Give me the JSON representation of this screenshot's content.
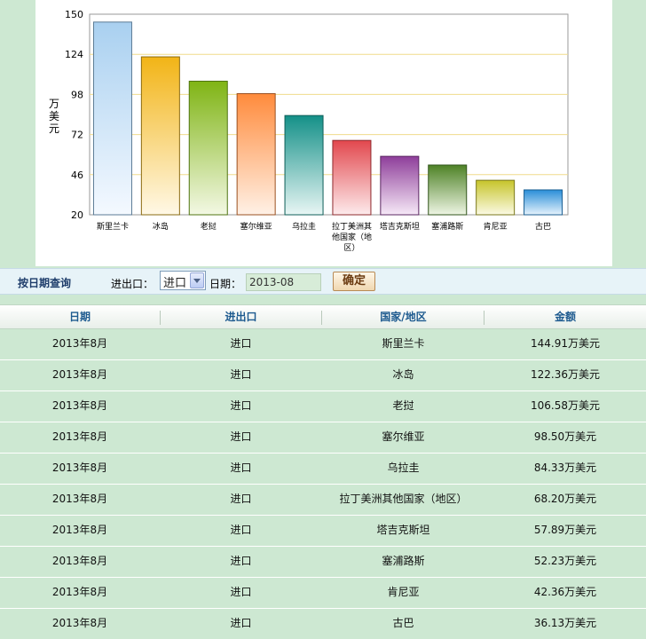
{
  "chart_data": {
    "type": "bar",
    "ylabel": "万美元",
    "ylim": [
      20,
      150
    ],
    "yticks": [
      150,
      124,
      98,
      72,
      46,
      20
    ],
    "grid": true,
    "categories": [
      "斯里兰卡",
      "冰岛",
      "老挝",
      "塞尔维亚",
      "乌拉圭",
      "拉丁美洲其他国家（地区）",
      "塔吉克斯坦",
      "塞浦路斯",
      "肯尼亚",
      "古巴"
    ],
    "values": [
      144.91,
      122.36,
      106.58,
      98.5,
      84.33,
      68.2,
      57.89,
      52.23,
      42.36,
      36.13
    ],
    "colors": [
      {
        "top": "#a9d0f0",
        "bottom": "#f4f9ff",
        "stroke": "#5a7a94"
      },
      {
        "top": "#f2b416",
        "bottom": "#fff8e6",
        "stroke": "#8a6a10"
      },
      {
        "top": "#7fb414",
        "bottom": "#f3f8e4",
        "stroke": "#4f7410"
      },
      {
        "top": "#ff8b3c",
        "bottom": "#fff1e6",
        "stroke": "#9a5020"
      },
      {
        "top": "#149088",
        "bottom": "#e8f6f4",
        "stroke": "#0e5e58"
      },
      {
        "top": "#e2484e",
        "bottom": "#fdebec",
        "stroke": "#8e2a2e"
      },
      {
        "top": "#8e3e9a",
        "bottom": "#f6e9f7",
        "stroke": "#5a2662"
      },
      {
        "top": "#4e8226",
        "bottom": "#eef5e4",
        "stroke": "#30541a"
      },
      {
        "top": "#c6c42a",
        "bottom": "#fbfae4",
        "stroke": "#7a781a"
      },
      {
        "top": "#2a8ed8",
        "bottom": "#e6f3fc",
        "stroke": "#1a5e92"
      }
    ]
  },
  "filter": {
    "title": "按日期查询",
    "type_label": "进出口：",
    "type_value": "进口",
    "date_label": "日期：",
    "date_value": "2013-08",
    "confirm_label": "确定"
  },
  "table": {
    "headers": [
      "日期",
      "进出口",
      "国家/地区",
      "金额"
    ],
    "rows": [
      [
        "2013年8月",
        "进口",
        "斯里兰卡",
        "144.91万美元"
      ],
      [
        "2013年8月",
        "进口",
        "冰岛",
        "122.36万美元"
      ],
      [
        "2013年8月",
        "进口",
        "老挝",
        "106.58万美元"
      ],
      [
        "2013年8月",
        "进口",
        "塞尔维亚",
        "98.50万美元"
      ],
      [
        "2013年8月",
        "进口",
        "乌拉圭",
        "84.33万美元"
      ],
      [
        "2013年8月",
        "进口",
        "拉丁美洲其他国家（地区）",
        "68.20万美元"
      ],
      [
        "2013年8月",
        "进口",
        "塔吉克斯坦",
        "57.89万美元"
      ],
      [
        "2013年8月",
        "进口",
        "塞浦路斯",
        "52.23万美元"
      ],
      [
        "2013年8月",
        "进口",
        "肯尼亚",
        "42.36万美元"
      ],
      [
        "2013年8月",
        "进口",
        "古巴",
        "36.13万美元"
      ]
    ]
  }
}
